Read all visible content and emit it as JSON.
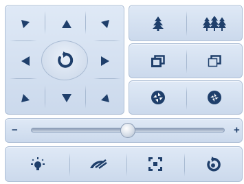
{
  "ptz": {
    "directions": [
      {
        "name": "up-left",
        "glyph": "◤"
      },
      {
        "name": "up",
        "glyph": "▲"
      },
      {
        "name": "up-right",
        "glyph": "◥"
      },
      {
        "name": "left",
        "glyph": "◀"
      },
      {
        "name": "right",
        "glyph": "▶"
      },
      {
        "name": "down-left",
        "glyph": "◣"
      },
      {
        "name": "down",
        "glyph": "▼"
      },
      {
        "name": "down-right",
        "glyph": "◢"
      }
    ],
    "center_icon": "auto-rotate-icon"
  },
  "zoom_panel": {
    "rows": [
      [
        "tree-single-icon",
        "trees-multiple-icon"
      ],
      [
        "window-restore-icon",
        "window-restore-outline-icon"
      ],
      [
        "aperture-open-icon",
        "aperture-close-icon"
      ]
    ]
  },
  "slider": {
    "minus_label": "−",
    "plus_label": "+",
    "value_fraction": 0.5
  },
  "bottom_toolbar": {
    "icons": [
      "light-bulb-icon",
      "wiper-icon",
      "focus-frame-icon",
      "rotate-reset-icon"
    ]
  },
  "colors": {
    "icon": "#1f3f6b",
    "panel_top": "#dfe9f6",
    "panel_bottom": "#cbd9ec",
    "border": "#aebfd6"
  }
}
